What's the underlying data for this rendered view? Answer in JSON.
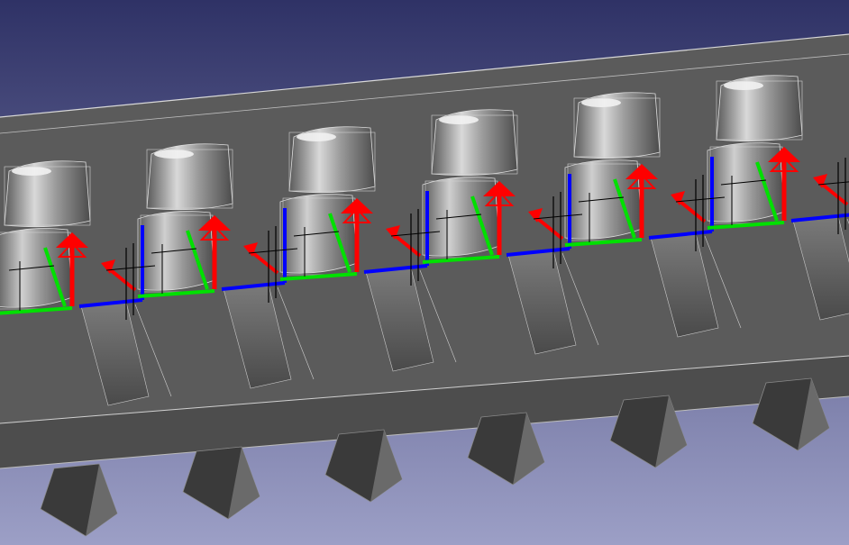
{
  "viewport": {
    "background_top": "#2f3266",
    "background_bottom": "#9c9fc6",
    "unit_count": 7
  },
  "colors": {
    "tray_body": "#5e5e5e",
    "tray_dark": "#3f3f3f",
    "tray_edge": "#dcdcdc",
    "foot": "#3a3a3a",
    "foot_face": "#6a6a6a",
    "cup": "#a8a8a8",
    "cup_highlight": "#f2f2f2",
    "axis_x": "#ff0000",
    "axis_y": "#00e000",
    "axis_z": "#0000ff",
    "gizmo_line": "#000000"
  }
}
